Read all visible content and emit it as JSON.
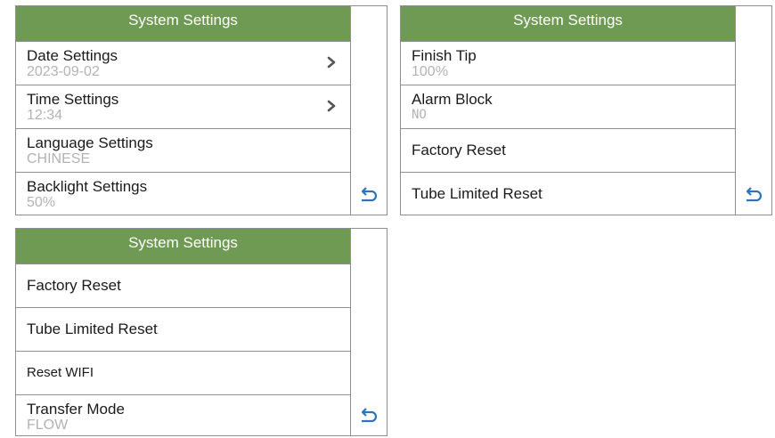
{
  "screen1": {
    "title": "System Settings",
    "items": [
      {
        "label": "Date Settings",
        "value": "2023-09-02"
      },
      {
        "label": "Time Settings",
        "value": "12:34"
      },
      {
        "label": "Language Settings",
        "value": "CHINESE"
      },
      {
        "label": "Backlight Settings",
        "value": "50%"
      }
    ]
  },
  "screen2": {
    "title": "System Settings",
    "items": [
      {
        "label": "Finish Tip",
        "value": "100%"
      },
      {
        "label": "Alarm Block",
        "value": "NO"
      },
      {
        "label": "Factory Reset"
      },
      {
        "label": "Tube Limited Reset"
      }
    ]
  },
  "screen3": {
    "title": "System Settings",
    "items": [
      {
        "label": "Factory Reset"
      },
      {
        "label": "Tube Limited Reset"
      },
      {
        "label": "Reset WIFI"
      },
      {
        "label": "Transfer Mode",
        "value": "FLOW"
      }
    ]
  },
  "colors": {
    "header_bg": "#6f9a53",
    "back_icon": "#2f73b8",
    "value_text": "#b3b3b3"
  },
  "icons": {
    "chevron": "chevron-right-icon",
    "back": "back-arrow-icon"
  }
}
